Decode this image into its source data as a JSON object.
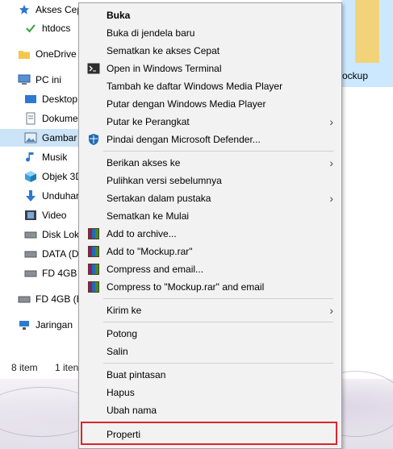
{
  "nav": {
    "items": [
      {
        "label": "Akses Cep",
        "icon": "star-icon"
      },
      {
        "label": "htdocs",
        "icon": "checkmark-icon"
      },
      {
        "label": "OneDrive",
        "icon": "folder-icon"
      },
      {
        "label": "PC ini",
        "icon": "computer-icon"
      },
      {
        "label": "Desktop",
        "icon": "desktop-icon"
      },
      {
        "label": "Dokume",
        "icon": "document-icon"
      },
      {
        "label": "Gambar",
        "icon": "picture-icon"
      },
      {
        "label": "Musik",
        "icon": "music-icon"
      },
      {
        "label": "Objek 3D",
        "icon": "cube-icon"
      },
      {
        "label": "Unduhar",
        "icon": "download-icon"
      },
      {
        "label": "Video",
        "icon": "film-icon"
      },
      {
        "label": "Disk Lok",
        "icon": "drive-icon"
      },
      {
        "label": "DATA (D",
        "icon": "drive-icon"
      },
      {
        "label": "FD 4GB (",
        "icon": "usb-drive-icon"
      },
      {
        "label": "FD 4GB (E",
        "icon": "usb-drive-icon"
      },
      {
        "label": "Jaringan",
        "icon": "network-icon"
      }
    ]
  },
  "status": {
    "item_count": "8 item",
    "selected": "1 iten"
  },
  "right_pane": {
    "label": "ockup"
  },
  "menu": {
    "items": [
      {
        "label": "Buka",
        "bold": true
      },
      {
        "label": "Buka di jendela baru"
      },
      {
        "label": "Sematkan ke akses Cepat"
      },
      {
        "label": "Open in Windows Terminal",
        "icon": "terminal-icon"
      },
      {
        "label": "Tambah ke daftar Windows Media Player"
      },
      {
        "label": "Putar dengan Windows Media Player"
      },
      {
        "label": "Putar ke Perangkat",
        "submenu": true
      },
      {
        "label": "Pindai dengan Microsoft Defender...",
        "icon": "defender-shield-icon"
      },
      {
        "label": "Berikan akses ke",
        "submenu": true
      },
      {
        "label": "Pulihkan versi sebelumnya"
      },
      {
        "label": "Sertakan dalam pustaka",
        "submenu": true
      },
      {
        "label": "Sematkan ke Mulai"
      },
      {
        "label": "Add to archive...",
        "icon": "winrar-icon"
      },
      {
        "label": "Add to \"Mockup.rar\"",
        "icon": "winrar-icon"
      },
      {
        "label": "Compress and email...",
        "icon": "winrar-icon"
      },
      {
        "label": "Compress to \"Mockup.rar\" and email",
        "icon": "winrar-icon"
      },
      {
        "label": "Kirim ke",
        "submenu": true
      },
      {
        "label": "Potong"
      },
      {
        "label": "Salin"
      },
      {
        "label": "Buat pintasan"
      },
      {
        "label": "Hapus"
      },
      {
        "label": "Ubah nama"
      },
      {
        "label": "Properti"
      }
    ],
    "chevron": "›"
  },
  "colors": {
    "highlight_box": "#d9262c",
    "selected_nav": "#cce4f7",
    "folder": "#f3d37a"
  }
}
